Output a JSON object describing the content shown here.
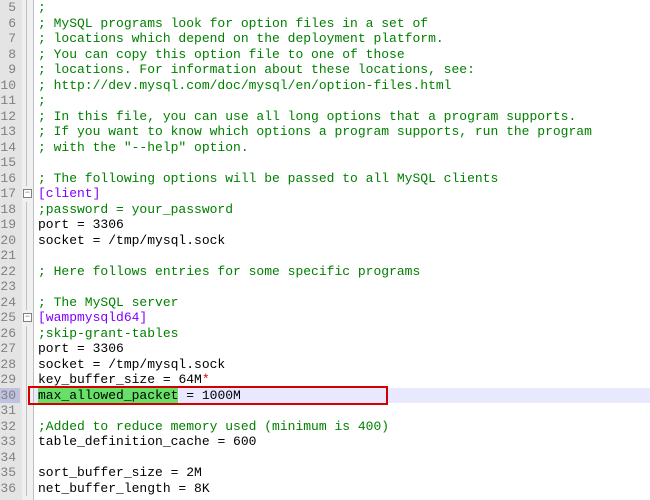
{
  "lines": [
    {
      "n": 5,
      "fold": "line",
      "cls": "cmt",
      "text": ";"
    },
    {
      "n": 6,
      "fold": "line",
      "cls": "cmt",
      "text": "; MySQL programs look for option files in a set of"
    },
    {
      "n": 7,
      "fold": "line",
      "cls": "cmt",
      "text": "; locations which depend on the deployment platform."
    },
    {
      "n": 8,
      "fold": "line",
      "cls": "cmt",
      "text": "; You can copy this option file to one of those"
    },
    {
      "n": 9,
      "fold": "line",
      "cls": "cmt",
      "text": "; locations. For information about these locations, see:"
    },
    {
      "n": 10,
      "fold": "line",
      "cls": "cmt",
      "text": "; http://dev.mysql.com/doc/mysql/en/option-files.html"
    },
    {
      "n": 11,
      "fold": "line",
      "cls": "cmt",
      "text": ";"
    },
    {
      "n": 12,
      "fold": "line",
      "cls": "cmt",
      "text": "; In this file, you can use all long options that a program supports."
    },
    {
      "n": 13,
      "fold": "line",
      "cls": "cmt",
      "text": "; If you want to know which options a program supports, run the program"
    },
    {
      "n": 14,
      "fold": "line",
      "cls": "cmt",
      "text": "; with the \"--help\" option."
    },
    {
      "n": 15,
      "fold": "line",
      "cls": "",
      "text": ""
    },
    {
      "n": 16,
      "fold": "line",
      "cls": "cmt",
      "text": "; The following options will be passed to all MySQL clients"
    },
    {
      "n": 17,
      "fold": "minus",
      "cls": "sect",
      "text": "[client]"
    },
    {
      "n": 18,
      "fold": "line",
      "cls": "cmt",
      "text": ";password = your_password"
    },
    {
      "n": 19,
      "fold": "line",
      "cls": "",
      "key": "port",
      "val": "3306"
    },
    {
      "n": 20,
      "fold": "line",
      "cls": "",
      "key": "socket",
      "val": "/tmp/mysql.sock"
    },
    {
      "n": 21,
      "fold": "line",
      "cls": "",
      "text": ""
    },
    {
      "n": 22,
      "fold": "line",
      "cls": "cmt",
      "text": "; Here follows entries for some specific programs"
    },
    {
      "n": 23,
      "fold": "line",
      "cls": "",
      "text": ""
    },
    {
      "n": 24,
      "fold": "line",
      "cls": "cmt",
      "text": "; The MySQL server"
    },
    {
      "n": 25,
      "fold": "minus",
      "cls": "sect",
      "text": "[wampmysqld64]"
    },
    {
      "n": 26,
      "fold": "line",
      "cls": "cmt",
      "text": ";skip-grant-tables"
    },
    {
      "n": 27,
      "fold": "line",
      "cls": "",
      "key": "port",
      "val": "3306"
    },
    {
      "n": 28,
      "fold": "line",
      "cls": "",
      "key": "socket",
      "val": "/tmp/mysql.sock"
    },
    {
      "n": 29,
      "fold": "line",
      "cls": "",
      "key": "key_buffer_size",
      "val": "64M",
      "star": true
    },
    {
      "n": 30,
      "fold": "line",
      "cls": "",
      "key": "max_allowed_packet",
      "val": "1000M",
      "current": true,
      "hlkey": true,
      "boxed": true
    },
    {
      "n": 31,
      "fold": "line",
      "cls": "",
      "text": ""
    },
    {
      "n": 32,
      "fold": "line",
      "cls": "cmt",
      "text": ";Added to reduce memory used (minimum is 400)"
    },
    {
      "n": 33,
      "fold": "line",
      "cls": "",
      "key": "table_definition_cache",
      "val": "600"
    },
    {
      "n": 34,
      "fold": "line",
      "cls": "",
      "text": ""
    },
    {
      "n": 35,
      "fold": "line",
      "cls": "",
      "key": "sort_buffer_size",
      "val": "2M"
    },
    {
      "n": 36,
      "fold": "line",
      "cls": "",
      "key": "net_buffer_length",
      "val": "8K"
    }
  ]
}
